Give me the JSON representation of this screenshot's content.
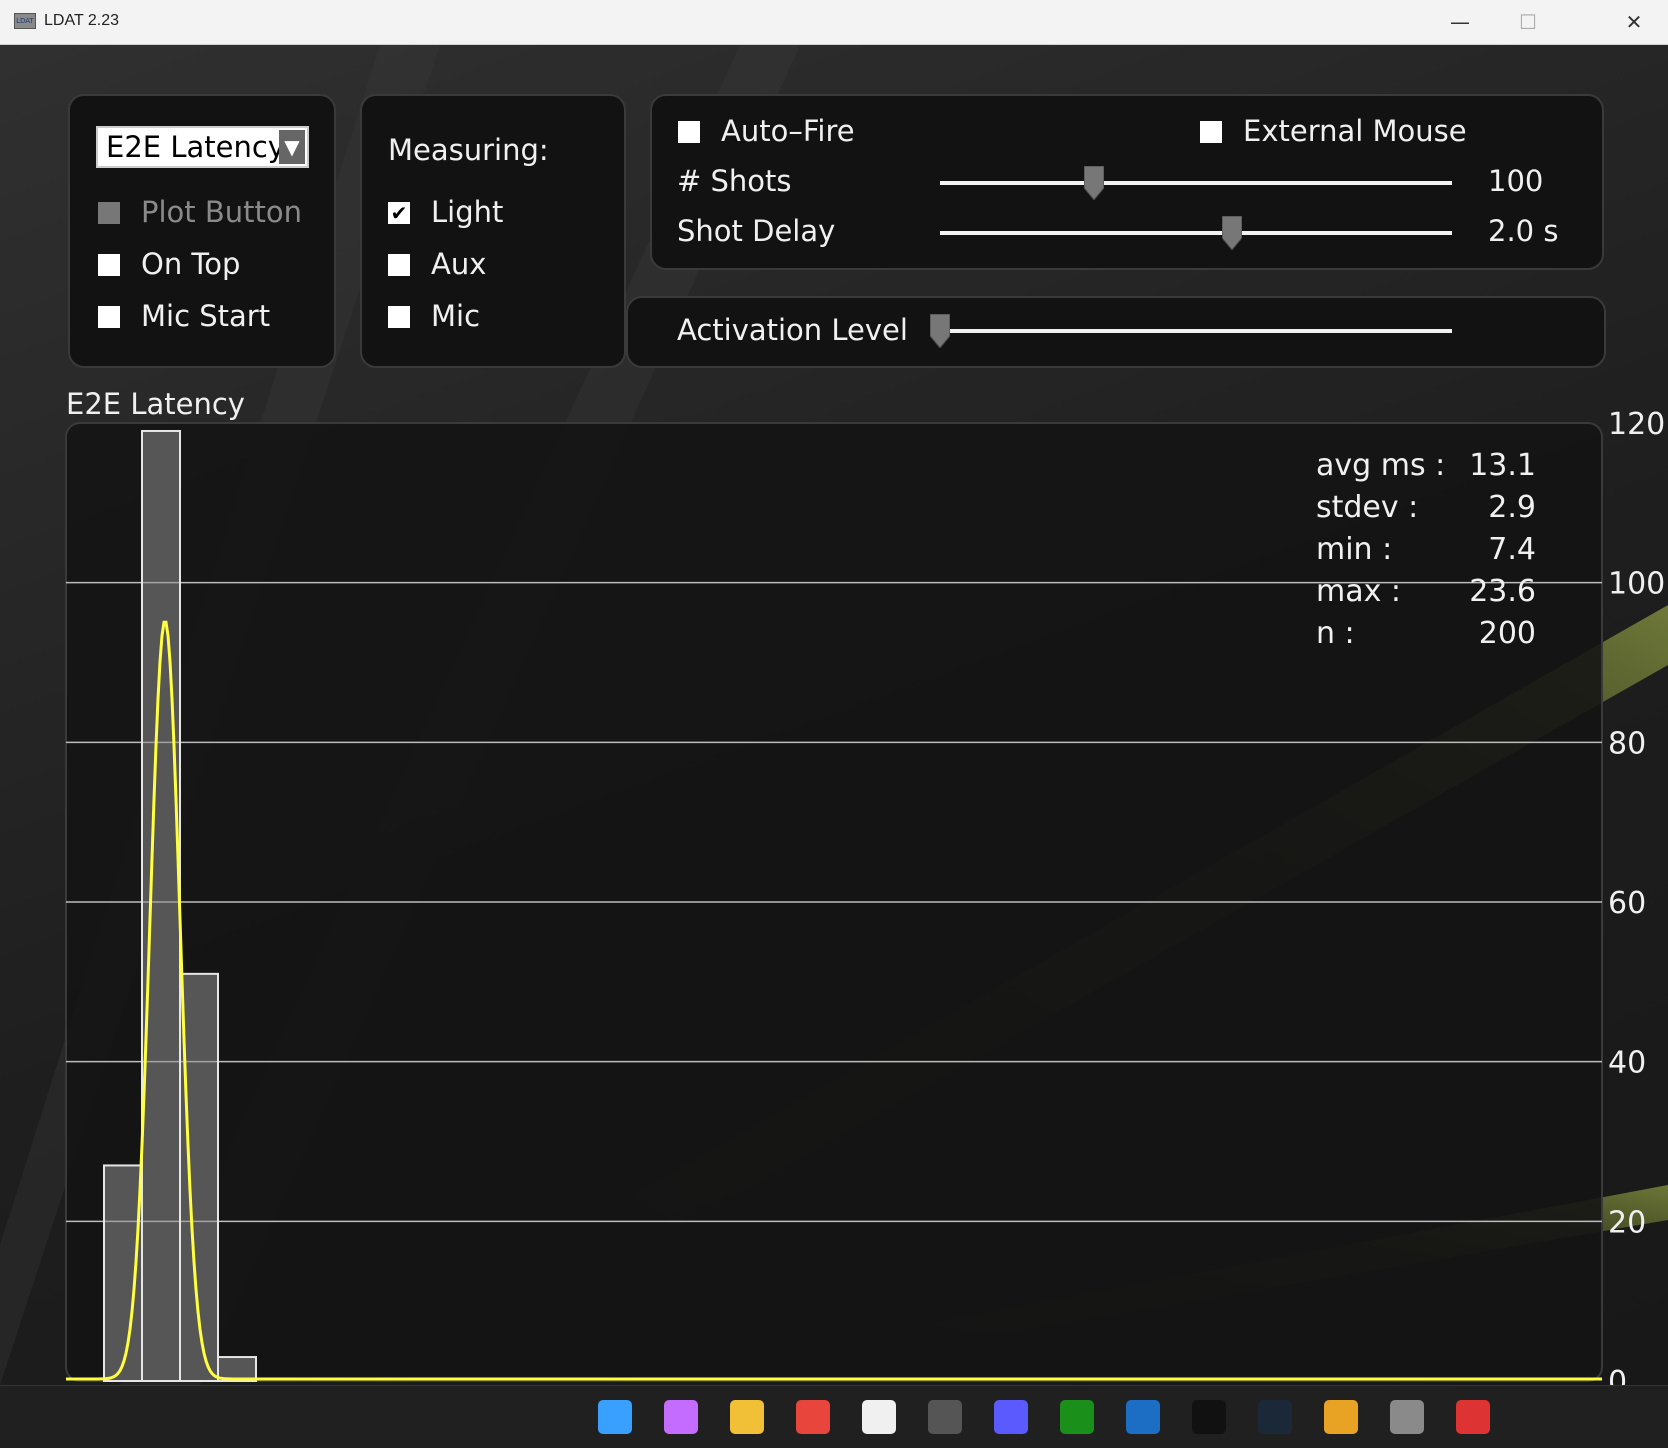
{
  "window": {
    "title": "LDAT 2.23",
    "icon_text": "LDAT",
    "minimize_glyph": "—",
    "maximize_glyph": "☐",
    "close_glyph": "✕"
  },
  "mode_panel": {
    "dropdown_value": "E2E Latency",
    "dropdown_arrow": "▼",
    "plot_button": {
      "label": "Plot Button",
      "checked": false,
      "enabled": false
    },
    "on_top": {
      "label": "On Top",
      "checked": false
    },
    "mic_start": {
      "label": "Mic Start",
      "checked": false
    }
  },
  "measuring_panel": {
    "title": "Measuring:",
    "light": {
      "label": "Light",
      "checked": true,
      "check_glyph": "✔"
    },
    "aux": {
      "label": "Aux",
      "checked": false
    },
    "mic": {
      "label": "Mic",
      "checked": false
    }
  },
  "fire_panel": {
    "auto_fire": {
      "label": "Auto–Fire",
      "checked": false
    },
    "external_mouse": {
      "label": "External Mouse",
      "checked": false
    },
    "shots": {
      "label": "# Shots",
      "value": "100",
      "slider_fraction": 0.3
    },
    "shot_delay": {
      "label": "Shot Delay",
      "value": "2.0 s",
      "slider_fraction": 0.57
    },
    "activation_level": {
      "label": "Activation Level",
      "slider_fraction": 0.0
    }
  },
  "chart_title": "E2E Latency",
  "stats": [
    {
      "key": "avg ms :",
      "value": "13.1"
    },
    {
      "key": "stdev :",
      "value": "2.9"
    },
    {
      "key": "min :",
      "value": "7.4"
    },
    {
      "key": "max :",
      "value": "23.6"
    },
    {
      "key": "n :",
      "value": "200"
    }
  ],
  "colors": {
    "bars": "#8c8c8c",
    "curve": "#ffff40",
    "grid": "#bdbdbd",
    "text": "#f0f0f0"
  },
  "chart_data": {
    "type": "bar",
    "title": "E2E Latency",
    "ylim": [
      0,
      120
    ],
    "y_ticks": [
      "0",
      "20",
      "40",
      "60",
      "80",
      "100",
      "120"
    ],
    "grid": true,
    "bins": [
      {
        "bin": 1,
        "value": 27
      },
      {
        "bin": 2,
        "value": 119
      },
      {
        "bin": 3,
        "value": 51
      },
      {
        "bin": 4,
        "value": 3
      }
    ],
    "curve_peak": 95
  },
  "taskbar": {
    "icons": [
      {
        "name": "windows-start-icon",
        "color": "#3aa0ff",
        "glyph": ""
      },
      {
        "name": "copilot-icon",
        "color": "#c46cff",
        "glyph": ""
      },
      {
        "name": "file-explorer-icon",
        "color": "#f2c037",
        "glyph": ""
      },
      {
        "name": "chrome-icon",
        "color": "#e8453c",
        "glyph": ""
      },
      {
        "name": "microsoft-store-icon",
        "color": "#f0f0f0",
        "glyph": ""
      },
      {
        "name": "unity-hub-icon",
        "color": "#555555",
        "glyph": ""
      },
      {
        "name": "visual-studio-icon",
        "color": "#5a5aff",
        "glyph": ""
      },
      {
        "name": "xbox-icon",
        "color": "#1a8f1a",
        "glyph": ""
      },
      {
        "name": "taskbar-app-icon",
        "color": "#1c6dc4",
        "glyph": ""
      },
      {
        "name": "fortnite-icon",
        "color": "#111111",
        "glyph": ""
      },
      {
        "name": "steam-icon",
        "color": "#1b2838",
        "glyph": ""
      },
      {
        "name": "counter-strike-icon",
        "color": "#e8a325",
        "glyph": ""
      },
      {
        "name": "ldat-taskbar-icon",
        "color": "#8a8a8a",
        "glyph": ""
      },
      {
        "name": "snipping-tool-icon",
        "color": "#d33",
        "glyph": ""
      }
    ]
  }
}
